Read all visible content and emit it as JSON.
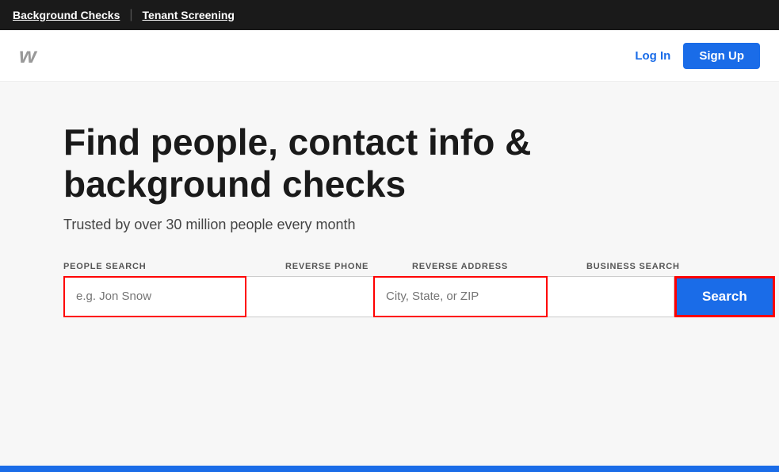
{
  "topbar": {
    "link1": "Background Checks",
    "divider": "|",
    "link2": "Tenant Screening"
  },
  "header": {
    "logo": "w",
    "login_label": "Log In",
    "signup_label": "Sign Up"
  },
  "main": {
    "headline": "Find people, contact info & background checks",
    "subheadline": "Trusted by over 30 million people every month",
    "tabs": [
      {
        "id": "people",
        "label": "PEOPLE SEARCH",
        "active": true
      },
      {
        "id": "phone",
        "label": "REVERSE PHONE",
        "active": false
      },
      {
        "id": "address",
        "label": "REVERSE ADDRESS",
        "active": false
      },
      {
        "id": "business",
        "label": "BUSINESS SEARCH",
        "active": false
      }
    ],
    "inputs": {
      "people_placeholder": "e.g. Jon Snow",
      "people_value": "",
      "phone_placeholder": "",
      "city_placeholder": "City, State, or ZIP",
      "city_value": "",
      "business_placeholder": ""
    },
    "search_button_label": "Search"
  }
}
